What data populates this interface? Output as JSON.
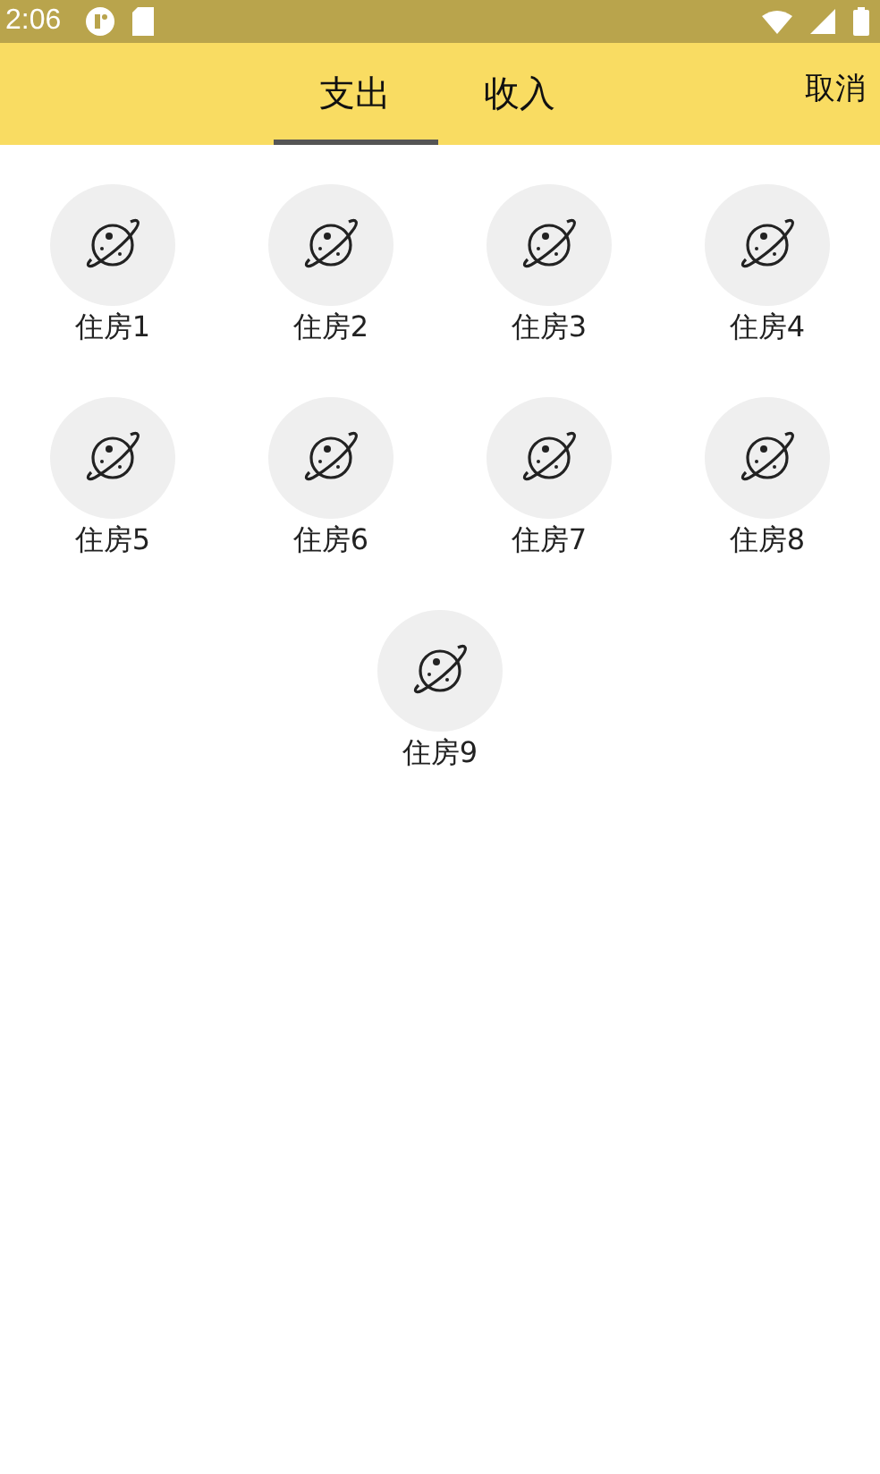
{
  "status_bar": {
    "time": "2:06"
  },
  "tabs": [
    {
      "label": "支出",
      "selected": true
    },
    {
      "label": "收入",
      "selected": false
    }
  ],
  "cancel": "取消",
  "categories": [
    {
      "label": "住房1"
    },
    {
      "label": "住房2"
    },
    {
      "label": "住房3"
    },
    {
      "label": "住房4"
    },
    {
      "label": "住房5"
    },
    {
      "label": "住房6"
    },
    {
      "label": "住房7"
    },
    {
      "label": "住房8"
    },
    {
      "label": "住房9"
    }
  ]
}
